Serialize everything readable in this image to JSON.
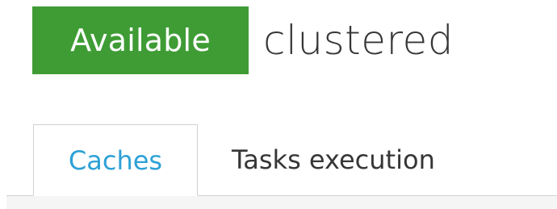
{
  "header": {
    "status_label": "Available",
    "cluster_name": "clustered"
  },
  "tabs": [
    {
      "label": "Caches",
      "active": true
    },
    {
      "label": "Tasks execution",
      "active": false
    }
  ],
  "colors": {
    "status_available": "#3f9c35",
    "tab_active_text": "#2da1d6",
    "text": "#363636",
    "border": "#d1d1d1"
  }
}
